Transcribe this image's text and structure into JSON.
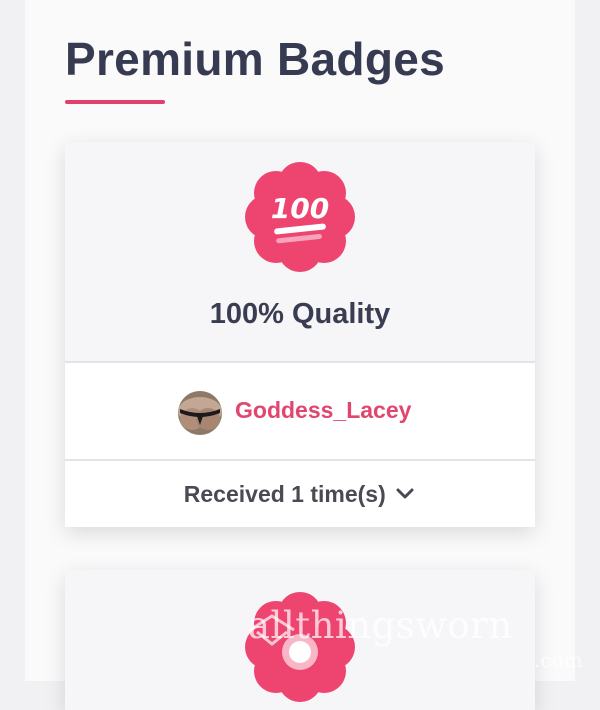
{
  "page": {
    "title": "Premium Badges",
    "accent_color": "#e0406b"
  },
  "badges": [
    {
      "icon": "hundred-points-icon",
      "name": "100% Quality",
      "user": {
        "username": "Goddess_Lacey",
        "avatar": "user-avatar"
      },
      "received": "Received 1 time(s)"
    },
    {
      "icon": "flower-badge-icon"
    }
  ],
  "watermark": {
    "text": "allthingsworn",
    "sub": ".com"
  }
}
